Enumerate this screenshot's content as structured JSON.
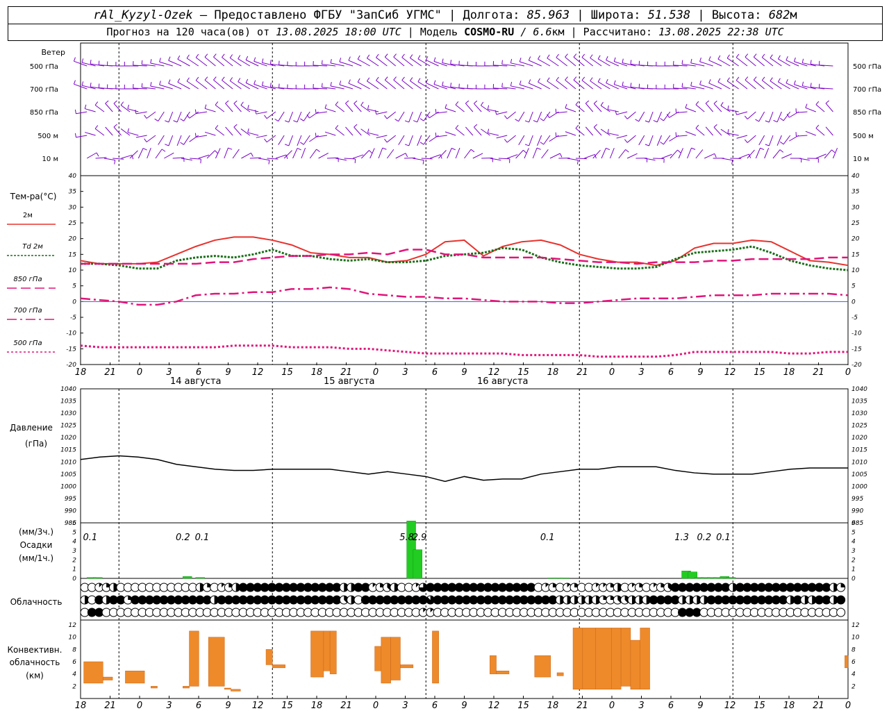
{
  "header": {
    "station": "rAl_Kyzyl-Ozek",
    "provider": " — Предоставлено ФГБУ \"ЗапСиб УГМС\" | ",
    "lon_label": "Долгота: ",
    "lon": "85.963",
    "lat_label": " | Широта: ",
    "lat": "51.538",
    "alt_label": " | Высота: ",
    "alt": "682",
    "alt_unit": "м",
    "forecast_label": "Прогноз на 120 часа(ов) от ",
    "issued": "13.08.2025 18:00 UTC",
    "model_label": " | Модель ",
    "model": "COSMO-RU",
    "res": " / 6.6",
    "res_unit": "км",
    "calc_label": " | Рассчитано: ",
    "calc": "13.08.2025 22:38 UTC"
  },
  "time_ticks": [
    "18",
    "21",
    "0",
    "3",
    "6",
    "9",
    "12",
    "15",
    "18",
    "21",
    "0",
    "3",
    "6",
    "9",
    "12",
    "15",
    "18",
    "21",
    "0",
    "3",
    "6",
    "9",
    "12",
    "15",
    "18",
    "21",
    "0"
  ],
  "dates": [
    "14 августа",
    "15 августа",
    "16 августа"
  ],
  "wind_panel": {
    "title": "Ветер",
    "levels": [
      "500 гПа",
      "700 гПа",
      "850 гПа",
      "500 м",
      "10  м"
    ]
  },
  "temp_panel": {
    "title": "Тем-ра(°C)",
    "legend": [
      {
        "label": "2м",
        "color": "#e8322d"
      },
      {
        "label": "Td  2м",
        "color": "#1a6e1a"
      },
      {
        "label": "850 гПа",
        "color": "#e0157a"
      },
      {
        "label": "700 гПа",
        "color": "#e0157a"
      },
      {
        "label": "500 гПа",
        "color": "#e0157a"
      }
    ]
  },
  "pressure_panel": {
    "title": "Давление",
    "unit": "(гПа)"
  },
  "precip_panel": {
    "unit3": "(мм/3ч.)",
    "title": "Осадки",
    "unit1": "(мм/1ч.)"
  },
  "cloud_panel": {
    "title": "Облачность"
  },
  "conv_panel": {
    "title1": "Конвективн.",
    "title2": "облачность",
    "unit": "(км)"
  },
  "chart_data": [
    {
      "type": "line",
      "name": "temperature",
      "x_hours": [
        0,
        3,
        6,
        9,
        12,
        15,
        18,
        21,
        24,
        27,
        30,
        33,
        36,
        39,
        42,
        45,
        48,
        51,
        54,
        57,
        60,
        63,
        66,
        69,
        72,
        75,
        78,
        81,
        84,
        87,
        90,
        93,
        96,
        99,
        102,
        105,
        108,
        111,
        114,
        117,
        120
      ],
      "ylim": [
        -20,
        40
      ],
      "yticks": [
        -20,
        -15,
        -10,
        -5,
        0,
        5,
        10,
        15,
        20,
        25,
        30,
        35,
        40
      ],
      "series": [
        {
          "name": "2м",
          "color": "#e8322d",
          "values": [
            13,
            12,
            12,
            12,
            12.5,
            15,
            17.5,
            19.5,
            20.5,
            20.5,
            19.5,
            18,
            15.5,
            15,
            14,
            14,
            12.5,
            13,
            15,
            19,
            19.5,
            14.5,
            17.5,
            19,
            19.5,
            18,
            15,
            13.5,
            12.5,
            12.5,
            11.5,
            13,
            17,
            18.5,
            18.5,
            19.5,
            19,
            16,
            13,
            12.5,
            11.5
          ]
        },
        {
          "name": "Td  2м",
          "color": "#1a6e1a",
          "values": [
            12,
            12,
            11.5,
            10.5,
            10.5,
            13,
            14,
            14.5,
            14,
            15,
            16.5,
            14.5,
            14.5,
            13.5,
            13,
            13.5,
            12.5,
            12.5,
            13,
            14.5,
            15,
            15.5,
            17,
            16.5,
            14,
            12.5,
            11.5,
            11,
            10.5,
            10.5,
            11,
            13.5,
            15.5,
            16,
            16.5,
            17.5,
            15.5,
            13,
            11.5,
            10.5,
            10
          ]
        },
        {
          "name": "850 гПа",
          "color": "#e0157a",
          "values": [
            12,
            12,
            12,
            12,
            12,
            12,
            12,
            12.5,
            12.5,
            13.5,
            14,
            14.5,
            14.5,
            15,
            15,
            15.5,
            15,
            16.5,
            16.5,
            15,
            15,
            14,
            14,
            14,
            14,
            13.5,
            13,
            12.5,
            12.5,
            12,
            12.5,
            12.5,
            12.5,
            13,
            13,
            13.5,
            13.5,
            13.5,
            13.5,
            14,
            14
          ]
        },
        {
          "name": "700 гПа",
          "color": "#e0157a",
          "values": [
            1,
            0.5,
            0,
            -1,
            -1,
            0,
            2,
            2.5,
            2.5,
            3,
            3,
            4,
            4,
            4.5,
            4,
            2.5,
            2,
            1.5,
            1.5,
            1,
            1,
            0.5,
            0,
            0,
            0,
            -0.5,
            -0.5,
            0,
            0.5,
            1,
            1,
            1,
            1.5,
            2,
            2,
            2,
            2.5,
            2.5,
            2.5,
            2.5,
            2
          ]
        },
        {
          "name": "500 гПа",
          "color": "#e0157a",
          "values": [
            -14,
            -14.5,
            -14.5,
            -14.5,
            -14.5,
            -14.5,
            -14.5,
            -14.5,
            -14,
            -14,
            -14,
            -14.5,
            -14.5,
            -14.5,
            -15,
            -15,
            -15.5,
            -16,
            -16.5,
            -16.5,
            -16.5,
            -16.5,
            -16.5,
            -17,
            -17,
            -17,
            -17,
            -17.5,
            -17.5,
            -17.5,
            -17.5,
            -17,
            -16,
            -16,
            -16,
            -16,
            -16,
            -16.5,
            -16.5,
            -16,
            -16
          ]
        }
      ]
    },
    {
      "type": "line",
      "name": "pressure",
      "x_hours": [
        0,
        3,
        6,
        9,
        12,
        15,
        18,
        21,
        24,
        27,
        30,
        33,
        36,
        39,
        42,
        45,
        48,
        51,
        54,
        57,
        60,
        63,
        66,
        69,
        72,
        75,
        78,
        81,
        84,
        87,
        90,
        93,
        96,
        99,
        102,
        105,
        108,
        111,
        114,
        117,
        120
      ],
      "ylim": [
        985,
        1040
      ],
      "yticks": [
        985,
        990,
        995,
        1000,
        1005,
        1010,
        1015,
        1020,
        1025,
        1030,
        1035,
        1040
      ],
      "series": [
        {
          "name": "",
          "color": "#000000",
          "values": [
            1011,
            1012,
            1012.5,
            1012,
            1011,
            1009,
            1008,
            1007,
            1006.5,
            1006.5,
            1007,
            1007,
            1007,
            1007,
            1006,
            1005,
            1006,
            1005,
            1004,
            1002,
            1004,
            1002.5,
            1003,
            1003,
            1005,
            1006,
            1007,
            1007,
            1008,
            1008,
            1008,
            1006.5,
            1005.5,
            1005,
            1005,
            1005,
            1006,
            1007,
            1007.5,
            1007.5,
            1007.5
          ]
        }
      ]
    },
    {
      "type": "bar",
      "name": "precipitation",
      "ylim": [
        0,
        6
      ],
      "yticks": [
        0,
        1,
        2,
        3,
        4,
        5,
        6
      ],
      "hourly": [
        [
          1,
          0.1
        ],
        [
          2,
          0.1
        ],
        [
          16,
          0.2
        ],
        [
          18,
          0.1
        ],
        [
          51,
          6.2
        ],
        [
          52,
          3.1
        ],
        [
          73,
          0.05
        ],
        [
          74,
          0.05
        ],
        [
          75,
          0.05
        ],
        [
          94,
          0.8
        ],
        [
          95,
          0.7
        ],
        [
          96,
          0.1
        ],
        [
          97,
          0.1
        ],
        [
          98,
          0.1
        ],
        [
          99,
          0.1
        ],
        [
          100,
          0.2
        ],
        [
          101,
          0.1
        ]
      ],
      "labels": [
        {
          "h": 1.5,
          "text": "0.1"
        },
        {
          "h": 16,
          "text": "0.2"
        },
        {
          "h": 19,
          "text": "0.1"
        },
        {
          "h": 51,
          "text": "5.8"
        },
        {
          "h": 53,
          "text": "2.9"
        },
        {
          "h": 73,
          "text": "0.1"
        },
        {
          "h": 94,
          "text": "1.3"
        },
        {
          "h": 97.5,
          "text": "0.2"
        },
        {
          "h": 100.5,
          "text": "0.1"
        }
      ]
    },
    {
      "type": "table",
      "name": "cloudiness",
      "rows": [
        "0012400000000000420124888888888888884488123400168888888888888880120120011240120123888888884888888888888842",
        "4084882888888888884888888888888888883408888888887888888888888888884444442233444888844448888888888848448848",
        "0880000000000000000000000000000000000000000000011000000000000000000000000000000000088800000000000000000000"
      ]
    },
    {
      "type": "bar",
      "name": "convective_clouds",
      "ylim": [
        0,
        12
      ],
      "yticks": [
        2,
        4,
        6,
        8,
        10,
        12
      ],
      "segments": [
        [
          0.5,
          3.5,
          2.5,
          6
        ],
        [
          3.5,
          5,
          3,
          3.5
        ],
        [
          7,
          10,
          2.5,
          4.5
        ],
        [
          11,
          12,
          1.7,
          2
        ],
        [
          16,
          17,
          1.7,
          2
        ],
        [
          17,
          18.5,
          2,
          11
        ],
        [
          20,
          22.5,
          2,
          10
        ],
        [
          22.5,
          23.5,
          1.5,
          1.7
        ],
        [
          23.5,
          25,
          1.2,
          1.5
        ],
        [
          29,
          30,
          5.5,
          8
        ],
        [
          30,
          32,
          5,
          5.5
        ],
        [
          36,
          38,
          3.5,
          11
        ],
        [
          38,
          39,
          4.5,
          11
        ],
        [
          39,
          40,
          4,
          11
        ],
        [
          46,
          47,
          4.5,
          8.5
        ],
        [
          47,
          48.5,
          2.5,
          10
        ],
        [
          48.5,
          50,
          3,
          10
        ],
        [
          50,
          52,
          5,
          5.5
        ],
        [
          55,
          56,
          2.5,
          11
        ],
        [
          64,
          65,
          4,
          7
        ],
        [
          65,
          67,
          4,
          4.5
        ],
        [
          71,
          73.5,
          3.5,
          7
        ],
        [
          74.5,
          75.5,
          3.7,
          4.2
        ],
        [
          77,
          78.5,
          1.5,
          11.5
        ],
        [
          78.5,
          80.5,
          1.5,
          11.5
        ],
        [
          80.5,
          83,
          1.5,
          11.5
        ],
        [
          83,
          84.5,
          1.5,
          11.5
        ],
        [
          84.5,
          86,
          2,
          11.5
        ],
        [
          86,
          87.5,
          1.5,
          9.5
        ],
        [
          87.5,
          89,
          1.5,
          11.5
        ],
        [
          119.5,
          120,
          5,
          7
        ]
      ]
    }
  ]
}
